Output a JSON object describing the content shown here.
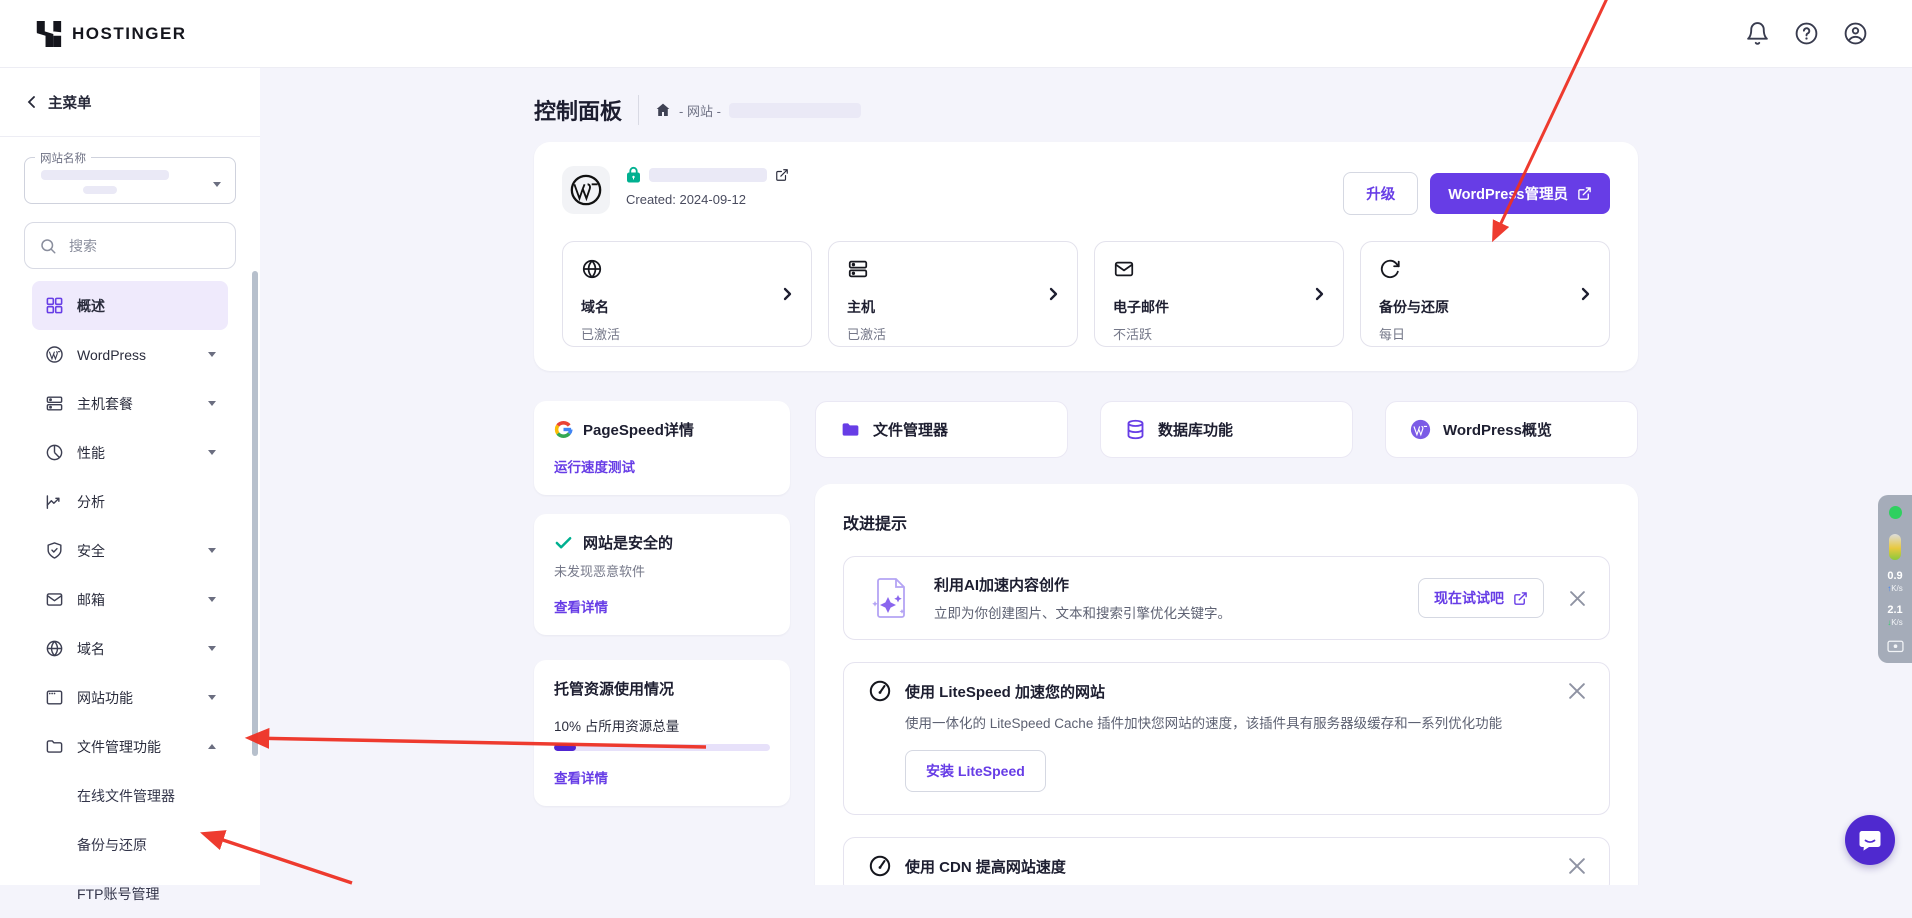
{
  "colors": {
    "brand_purple": "#673de6",
    "progress_fill": "#5025d1",
    "success_green": "#00b090",
    "arrow_red": "#ee3124",
    "chat_bubble": "#4f29cf",
    "active_item_bg": "#efeafc",
    "page_bg": "#f4f4fb"
  },
  "header": {
    "brand": "HOSTINGER"
  },
  "sidebar": {
    "back_label": "主菜单",
    "site_select_label": "网站名称",
    "search_placeholder": "搜索",
    "items": [
      {
        "label": "概述",
        "icon": "grid-icon",
        "active": true
      },
      {
        "label": "WordPress",
        "icon": "wordpress-icon",
        "expandable": true
      },
      {
        "label": "主机套餐",
        "icon": "server-icon",
        "expandable": true
      },
      {
        "label": "性能",
        "icon": "pie-icon",
        "expandable": true
      },
      {
        "label": "分析",
        "icon": "trend-icon"
      },
      {
        "label": "安全",
        "icon": "shield-icon",
        "expandable": true
      },
      {
        "label": "邮箱",
        "icon": "mail-icon",
        "expandable": true
      },
      {
        "label": "域名",
        "icon": "globe-icon",
        "expandable": true
      },
      {
        "label": "网站功能",
        "icon": "browser-icon",
        "expandable": true
      },
      {
        "label": "文件管理功能",
        "icon": "folder-icon",
        "expandable": true,
        "expanded": true
      }
    ],
    "subitems": [
      {
        "label": "在线文件管理器"
      },
      {
        "label": "备份与还原"
      },
      {
        "label": "FTP账号管理"
      }
    ]
  },
  "page": {
    "title": "控制面板",
    "breadcrumb": "- 网站 -"
  },
  "site_card": {
    "created": "Created: 2024-09-12",
    "upgrade_label": "升级",
    "wp_admin_label": "WordPress管理员",
    "services": [
      {
        "title": "域名",
        "status": "已激活",
        "icon": "globe-icon"
      },
      {
        "title": "主机",
        "status": "已激活",
        "icon": "server-icon"
      },
      {
        "title": "电子邮件",
        "status": "不活跃",
        "icon": "mail-icon"
      },
      {
        "title": "备份与还原",
        "status": "每日",
        "icon": "sync-icon"
      }
    ]
  },
  "quick_cards": {
    "pagespeed_title": "PageSpeed详情",
    "pagespeed_link": "运行速度测试",
    "file_manager": "文件管理器",
    "database": "数据库功能",
    "wordpress_overview": "WordPress概览"
  },
  "security_card": {
    "title": "网站是安全的",
    "subtitle": "未发现恶意软件",
    "link": "查看详情"
  },
  "resources_card": {
    "title": "托管资源使用情况",
    "usage_text": "10% 占所用资源总量",
    "usage_percent": 10,
    "link": "查看详情"
  },
  "tips": {
    "heading": "改进提示",
    "items": [
      {
        "title": "利用AI加速内容创作",
        "body": "立即为你创建图片、文本和搜索引擎优化关键字。",
        "cta": "现在试试吧"
      },
      {
        "title": "使用 LiteSpeed 加速您的网站",
        "body": "使用一体化的 LiteSpeed Cache 插件加快您网站的速度，该插件具有服务器级缓存和一系列优化功能",
        "cta": "安装 LiteSpeed"
      },
      {
        "title": "使用 CDN 提高网站速度"
      }
    ]
  },
  "net_monitor": {
    "upload_value": "0.9",
    "upload_unit": "K/s",
    "download_value": "2.1",
    "download_unit": "K/s"
  }
}
